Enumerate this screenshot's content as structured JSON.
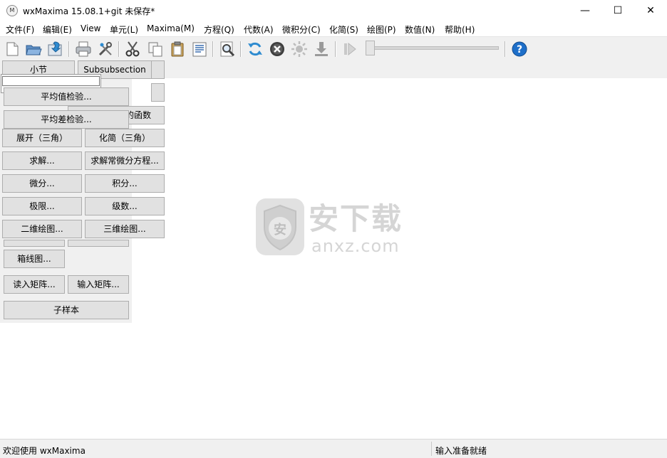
{
  "window": {
    "title": "wxMaxima 15.08.1+git 未保存*",
    "icon": "wxmaxima-logo-icon",
    "icon_glyph": "M",
    "minimize": "—",
    "maximize": "☐",
    "close": "✕"
  },
  "menu": [
    "文件(F)",
    "编辑(E)",
    "View",
    "单元(L)",
    "Maxima(M)",
    "方程(Q)",
    "代数(A)",
    "微积分(C)",
    "化简(S)",
    "绘图(P)",
    "数值(N)",
    "帮助(H)"
  ],
  "toolbar": {
    "icons": [
      "new-file-icon",
      "open-folder-icon",
      "save-icon",
      "print-icon",
      "config-icon",
      "cut-icon",
      "copy-icon",
      "paste-icon",
      "select-all-icon",
      "find-icon",
      "restart-icon",
      "interrupt-icon",
      "follow-icon",
      "animation-stop-icon",
      "animation-play-icon"
    ],
    "slider_value": 0
  },
  "panel": {
    "row0": [
      "小节",
      "Subsubsection"
    ],
    "popup_buttons": [
      "平均值检验...",
      "平均差检验..."
    ],
    "partial_label": "的函数",
    "rows": [
      [
        "展开（三角）",
        "化简（三角）"
      ],
      [
        "求解...",
        "求解常微分方程..."
      ],
      [
        "微分...",
        "积分..."
      ],
      [
        "极限...",
        "级数..."
      ],
      [
        "二维绘图...",
        "三维绘图..."
      ]
    ],
    "boxplot": "箱线图...",
    "matrix_read": "读入矩阵...",
    "matrix_write": "输入矩阵...",
    "subsample": "子样本"
  },
  "status": {
    "left": "欢迎使用 wxMaxima",
    "right": "输入准备就绪"
  },
  "watermark": {
    "cn": "安下载",
    "domain": "anxz.com",
    "shield_char": "安"
  },
  "colors": {
    "accent": "#1e6fc9",
    "stop_red": "#c62828",
    "panel_bg": "#f0f0f0",
    "button_bg": "#e1e1e1"
  }
}
